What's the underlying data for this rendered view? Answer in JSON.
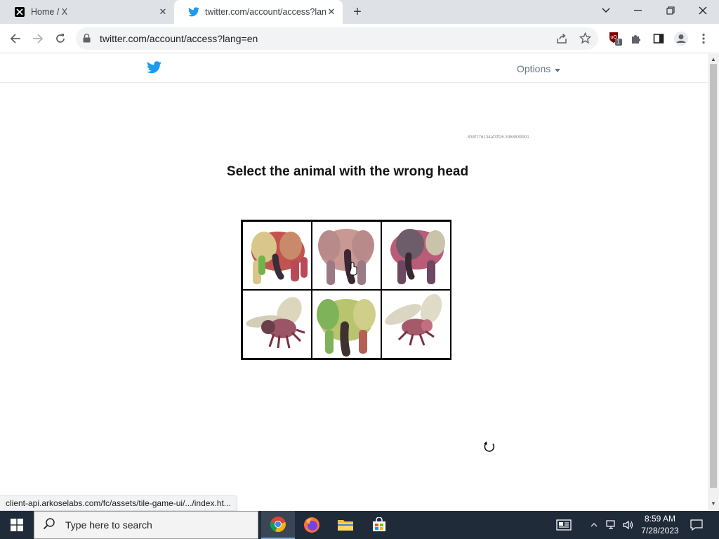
{
  "tabs": [
    {
      "title": "Home / X",
      "active": false
    },
    {
      "title": "twitter.com/account/access?lang",
      "active": true
    }
  ],
  "address_bar": {
    "url": "twitter.com/account/access?lang=en"
  },
  "extension_badge": "1",
  "header": {
    "options_label": "Options"
  },
  "captcha": {
    "session_id": "838f776134af3ff26.3468839901",
    "prompt": "Select the animal with the wrong head",
    "tiles": [
      {
        "animal": "elephant",
        "selected": false
      },
      {
        "animal": "elephant",
        "selected": true
      },
      {
        "animal": "elephant",
        "selected": false
      },
      {
        "animal": "bee",
        "selected": false
      },
      {
        "animal": "elephant",
        "selected": false
      },
      {
        "animal": "bee",
        "selected": false
      }
    ]
  },
  "status_bar": {
    "text": "client-api.arkoselabs.com/fc/assets/tile-game-ui/.../index.ht..."
  },
  "taskbar": {
    "search_placeholder": "Type here to search",
    "time": "8:59 AM",
    "date": "7/28/2023"
  },
  "colors": {
    "twitter_blue": "#1d9bf0",
    "taskbar": "#202b3a"
  }
}
